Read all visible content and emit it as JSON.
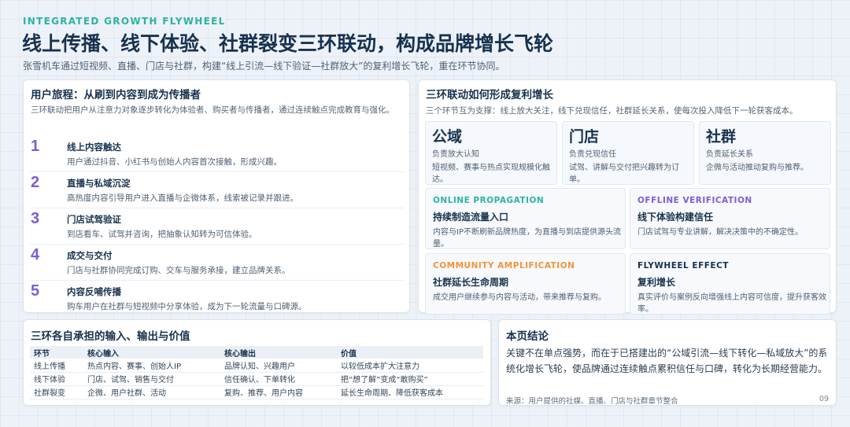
{
  "header": {
    "eyebrow": "INTEGRATED GROWTH FLYWHEEL",
    "title": "线上传播、线下体验、社群裂变三环联动，构成品牌增长飞轮",
    "subtitle": "张雪机车通过短视频、直播、门店与社群，构建“线上引流—线下验证—社群放大”的复利增长飞轮，重在环节协同。"
  },
  "journey": {
    "title": "用户旅程：从刷到内容到成为传播者",
    "desc": "三环联动把用户从注意力对象逐步转化为体验者、购买者与传播者，通过连续触点完成教育与强化。",
    "steps": [
      {
        "num": "1",
        "title": "线上内容触达",
        "desc": "用户通过抖音、小红书与创始人内容首次接触，形成兴趣。"
      },
      {
        "num": "2",
        "title": "直播与私域沉淀",
        "desc": "高热度内容引导用户进入直播与企微体系，线索被记录并跟进。"
      },
      {
        "num": "3",
        "title": "门店试驾验证",
        "desc": "到店看车、试驾并咨询，把抽象认知转为可信体验。"
      },
      {
        "num": "4",
        "title": "成交与交付",
        "desc": "门店与社群协同完成订购、交车与服务承接，建立品牌关系。"
      },
      {
        "num": "5",
        "title": "内容反哺传播",
        "desc": "购车用户在社群与短视频中分享体验，成为下一轮流量与口碑源。"
      }
    ]
  },
  "rings": {
    "title": "三环联动如何形成复利增长",
    "desc": "三个环节互为支撑：线上放大关注，线下兑现信任，社群延长关系，使每次投入降低下一轮获客成本。",
    "cards": [
      {
        "name": "公域",
        "role": "负责放大认知",
        "desc": "短视频、赛事与热点实现规模化触达。"
      },
      {
        "name": "门店",
        "role": "负责兑现信任",
        "desc": "试驾、讲解与交付把兴趣转为订单。"
      },
      {
        "name": "社群",
        "role": "负责延长关系",
        "desc": "企微与活动推动复购与推荐。"
      }
    ],
    "flows": [
      {
        "tag": "ONLINE PROPAGATION",
        "color": "#2bb3a3",
        "title": "持续制造流量入口",
        "desc": "内容与IP不断刷新品牌热度，为直播与到店提供源头流量。"
      },
      {
        "tag": "OFFLINE VERIFICATION",
        "color": "#7b5cd9",
        "title": "线下体验构建信任",
        "desc": "门店试驾与专业讲解，解决决策中的不确定性。"
      },
      {
        "tag": "COMMUNITY AMPLIFICATION",
        "color": "#f0943a",
        "title": "社群延长生命周期",
        "desc": "成交用户继续参与内容与活动，带来推荐与复购。"
      },
      {
        "tag": "FLYWHEEL EFFECT",
        "color": "#17324e",
        "title": "复利增长",
        "desc": "真实评价与案例反向增强线上内容可信度，提升获客效率。"
      }
    ]
  },
  "io": {
    "title": "三环各自承担的输入、输出与价值",
    "headers": [
      "环节",
      "核心输入",
      "核心输出",
      "价值"
    ],
    "rows": [
      [
        "线上传播",
        "热点内容、赛事、创始人IP",
        "品牌认知、兴趣用户",
        "以较低成本扩大注意力"
      ],
      [
        "线下体验",
        "门店、试驾、销售与交付",
        "信任确认、下单转化",
        "把“想了解”变成“敢购买”"
      ],
      [
        "社群裂变",
        "企微、用户社群、活动",
        "复购、推荐、用户内容",
        "延长生命周期、降低获客成本"
      ]
    ]
  },
  "conclusion": {
    "title": "本页结论",
    "text": "关键不在单点强势，而在于已搭建出的“公域引流—线下转化—私域放大”的系统化增长飞轮，使品牌通过连续触点累积信任与口碑，转化为长期经营能力。",
    "source": "来源：用户提供的社媒、直播、门店与社群章节整合",
    "page": "09"
  }
}
